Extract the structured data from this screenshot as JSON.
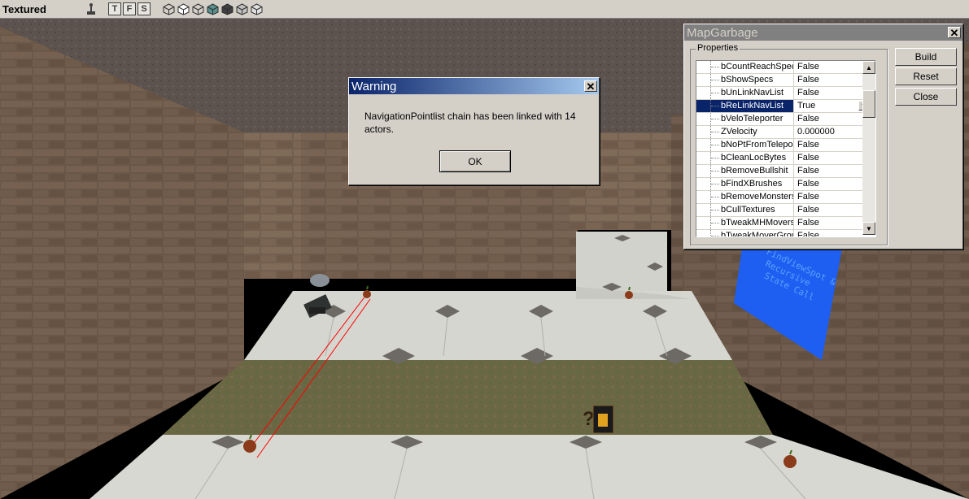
{
  "viewport": {
    "mode_label": "Textured",
    "toolbar": {
      "pin_icon": "joystick-icon",
      "view_buttons": [
        "T",
        "F",
        "S"
      ],
      "render_icons": [
        "wireframe-cube-icon",
        "zone-cube-icon",
        "texture-usage-cube-icon",
        "lit-cube-icon",
        "bsp-cube-icon",
        "dynamic-light-cube-icon",
        "unlit-cube-icon"
      ]
    }
  },
  "scene": {
    "banner_text": [
      "FindViewSpot &",
      "Recursive",
      "State Call"
    ],
    "colors": {
      "stone_wall": "#6f5e50",
      "floor_tile": "#d2d2cc",
      "ceiling": "#5e5450",
      "grass": "#6b6a45",
      "banner": "#1e5ef0",
      "path_line": "#ff0000"
    }
  },
  "warning_dialog": {
    "title": "Warning",
    "message": "NavigationPointlist chain has been linked with 14 actors.",
    "ok_label": "OK"
  },
  "mapgarbage": {
    "title": "MapGarbage",
    "group_label": "Properties",
    "properties": [
      {
        "name": "bCountReachSpecs",
        "value": "False"
      },
      {
        "name": "bShowSpecs",
        "value": "False"
      },
      {
        "name": "bUnLinkNavList",
        "value": "False"
      },
      {
        "name": "bReLinkNavList",
        "value": "True",
        "selected": true
      },
      {
        "name": "bVeloTeleporter",
        "value": "False"
      },
      {
        "name": "ZVelocity",
        "value": "0.000000"
      },
      {
        "name": "bNoPtFromTeleporter",
        "value": "False"
      },
      {
        "name": "bCleanLocBytes",
        "value": "False"
      },
      {
        "name": "bRemoveBullshit",
        "value": "False"
      },
      {
        "name": "bFindXBrushes",
        "value": "False"
      },
      {
        "name": "bRemoveMonsters",
        "value": "False"
      },
      {
        "name": "bCullTextures",
        "value": "False"
      },
      {
        "name": "bTweakMHMovers",
        "value": "False"
      },
      {
        "name": "bTweakMoverGroup",
        "value": "False"
      }
    ],
    "buttons": {
      "build": "Build",
      "reset": "Reset",
      "close": "Close"
    }
  }
}
